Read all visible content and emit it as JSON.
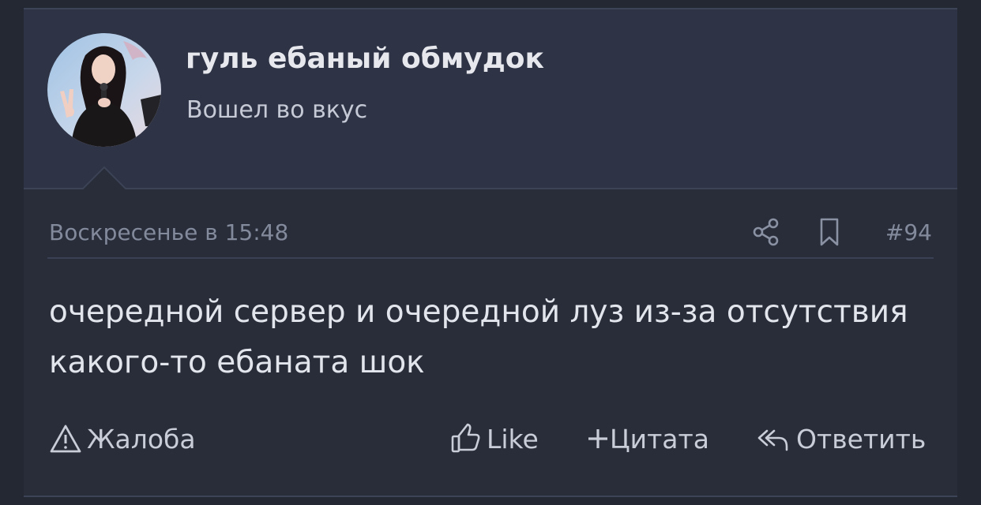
{
  "author": {
    "name": "гуль ебаный обмудок",
    "title": "Вошел во вкус",
    "avatar_icon": "avatar-photo"
  },
  "post": {
    "date": "Воскресенье в 15:48",
    "number": "#94",
    "body": "очередной сервер и очередной луз из-за отсутствия какого-то ебаната шок",
    "share_icon": "share-icon",
    "bookmark_icon": "bookmark-icon"
  },
  "actions": {
    "report": "Жалоба",
    "like": "Like",
    "quote": "Цитата",
    "reply": "Ответить"
  },
  "colors": {
    "background": "#232833",
    "author_bar": "#2e3446",
    "post_bg": "#282d39",
    "text": "#e2e5ec",
    "muted": "#838a9c"
  }
}
